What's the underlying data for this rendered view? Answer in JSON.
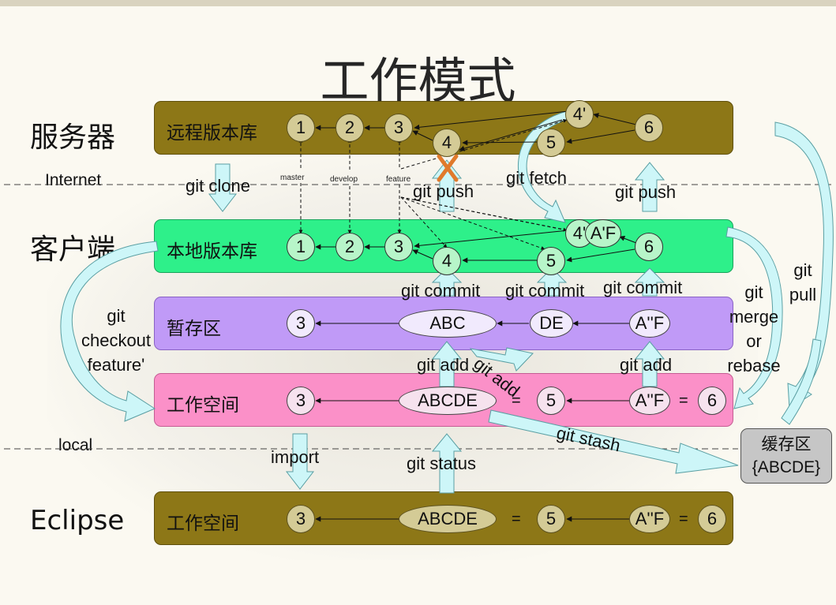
{
  "title": "工作模式",
  "side_labels": {
    "server": "服务器",
    "client": "客户端",
    "eclipse": "Eclipse",
    "internet": "Internet",
    "local": "local"
  },
  "bands": {
    "remote": "远程版本库",
    "local_repo": "本地版本库",
    "staging": "暂存区",
    "workspace": "工作空间",
    "eclipse_workspace": "工作空间"
  },
  "remote_nodes": [
    "1",
    "2",
    "3",
    "4",
    "4'",
    "5",
    "6"
  ],
  "local_nodes": [
    "1",
    "2",
    "3",
    "4",
    "4'",
    "A'F",
    "5",
    "6"
  ],
  "staging_nodes": [
    "3",
    "ABC",
    "DE",
    "A''F"
  ],
  "workspace_nodes": [
    "3",
    "ABCDE",
    "=",
    "5",
    "A''F",
    "=",
    "6"
  ],
  "eclipse_nodes": [
    "3",
    "ABCDE",
    "=",
    "5",
    "A''F",
    "=",
    "6"
  ],
  "branches": {
    "master": "master",
    "develop": "develop",
    "feature": "feature"
  },
  "commands": {
    "clone": "git clone",
    "push1": "git push",
    "fetch": "git fetch",
    "push2": "git push",
    "commit1": "git commit",
    "commit2": "git commit",
    "commit3": "git commit",
    "add1": "git add",
    "add_diag": "git add",
    "add2": "git add",
    "checkout": [
      "git",
      "checkout",
      "feature'"
    ],
    "merge": [
      "git",
      "merge",
      "or",
      "rebase"
    ],
    "pull": [
      "git",
      "pull"
    ],
    "stash": "git stash",
    "import": "import",
    "status": "git status"
  },
  "stash": {
    "title": "缓存区",
    "content": "{ABCDE}"
  },
  "colors": {
    "remote_band": "#8d7717",
    "local_band": "#2ef08a",
    "staging_band": "#c09af7",
    "workspace_band": "#fb90c8",
    "arrow_fill": "#cdf6f8",
    "conflict_x": "#e07a2c"
  }
}
